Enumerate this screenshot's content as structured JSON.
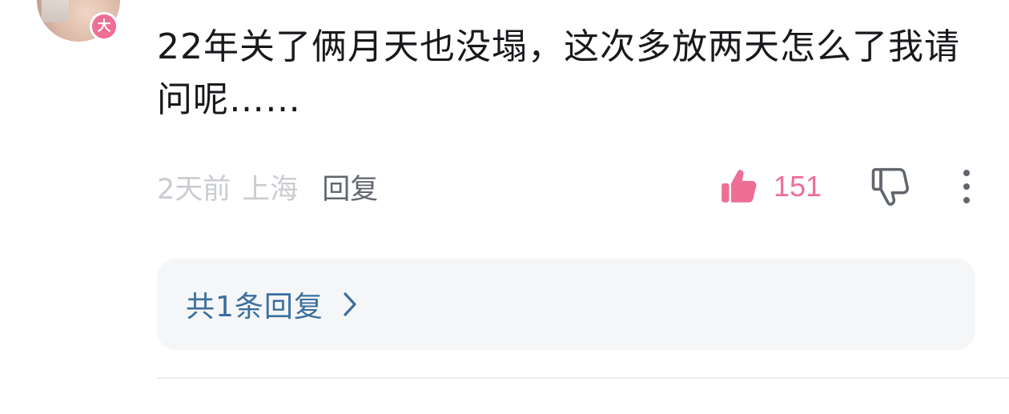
{
  "comment": {
    "avatar_badge": "大",
    "text": "22年关了俩月天也没塌，这次多放两天怎么了我请问呢……",
    "time": "2天前",
    "location": "上海",
    "reply_label": "回复",
    "like_count": "151",
    "colors": {
      "like": "#ee6e94",
      "reply_link": "#3a6f9e",
      "meta_text": "#c9ccd0",
      "body_text": "#18191c"
    }
  },
  "replies": {
    "summary": "共1条回复",
    "chevron_icon": "chevron-right-icon"
  },
  "icons": {
    "like": "thumbs-up-icon",
    "dislike": "thumbs-down-icon",
    "more": "more-vertical-icon"
  }
}
